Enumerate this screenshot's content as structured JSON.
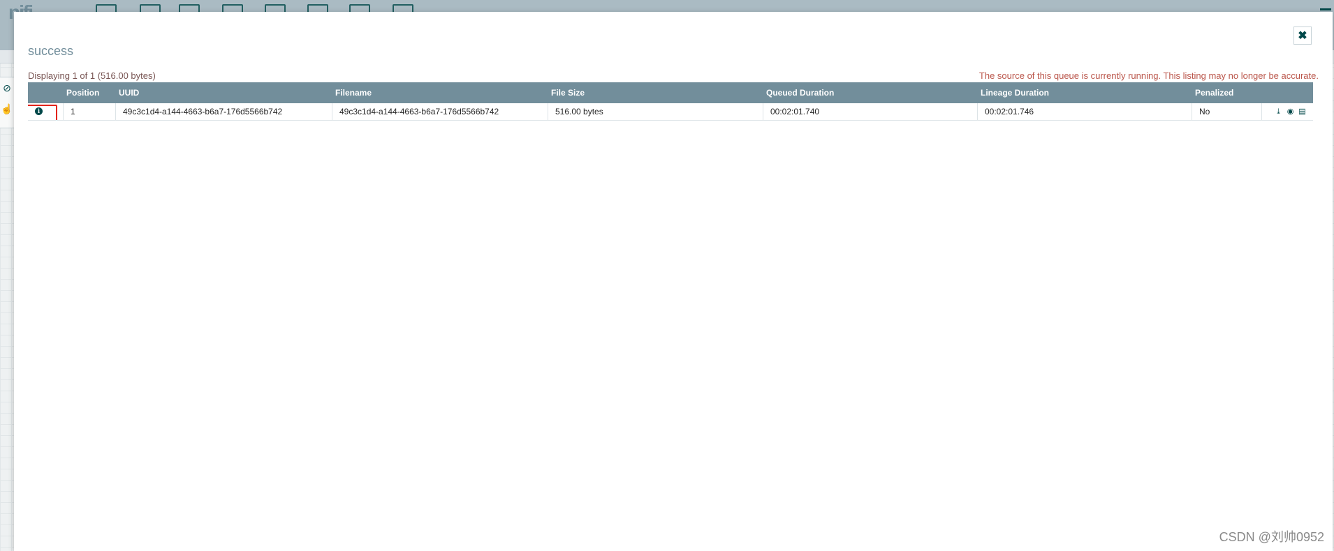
{
  "background": {
    "app_logo": "nifi",
    "toolbar_icons": [
      "operate-icon",
      "processor-icon",
      "input-port-icon",
      "output-port-icon",
      "process-group-icon",
      "remote-group-icon",
      "funnel-icon",
      "template-icon",
      "label-icon"
    ]
  },
  "dialog": {
    "title": "success",
    "close_icon": "close-icon",
    "summary": "Displaying 1 of 1 (516.00 bytes)",
    "warning": "The source of this queue is currently running. This listing may no longer be accurate.",
    "table": {
      "columns": [
        "",
        "Position",
        "UUID",
        "Filename",
        "File Size",
        "Queued Duration",
        "Lineage Duration",
        "Penalized",
        ""
      ],
      "rows": [
        {
          "position": "1",
          "uuid": "49c3c1d4-a144-4663-b6a7-176d5566b742",
          "filename": "49c3c1d4-a144-4663-b6a7-176d5566b742",
          "file_size": "516.00 bytes",
          "queued_duration": "00:02:01.740",
          "lineage_duration": "00:02:01.746",
          "penalized": "No"
        }
      ],
      "row_actions": [
        "download-icon",
        "view-icon",
        "provenance-icon"
      ]
    }
  },
  "watermark": "CSDN @刘帅0952",
  "colors": {
    "header": "#728e9b",
    "accent": "#004849",
    "warning": "#ba554a",
    "highlight": "#e2231a"
  }
}
